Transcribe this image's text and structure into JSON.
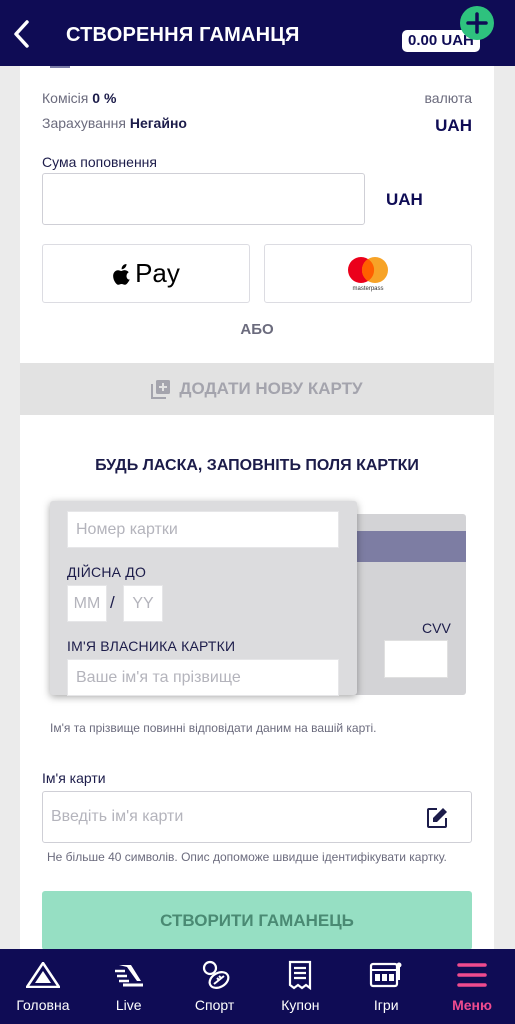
{
  "header": {
    "title": "СТВОРЕННЯ ГАМАНЦЯ",
    "balance": "0.00 UAH"
  },
  "info": {
    "commission_label": "Комісія",
    "commission_value": "0 %",
    "crediting_label": "Зарахування",
    "crediting_value": "Негайно",
    "currency_label": "валюта",
    "currency_value": "UAH"
  },
  "amount": {
    "label": "Сума поповнення",
    "value": "",
    "currency": "UAH"
  },
  "payment": {
    "applepay_label": "Pay",
    "masterpass_label": "masterpass",
    "or_label": "АБО"
  },
  "add_card": {
    "label": "ДОДАТИ НОВУ КАРТУ"
  },
  "card_form": {
    "title": "БУДЬ ЛАСКА, ЗАПОВНІТЬ ПОЛЯ КАРТКИ",
    "number_placeholder": "Номер картки",
    "valid_label": "ДІЙСНА ДО",
    "mm_placeholder": "MM",
    "slash": "/",
    "yy_placeholder": "YY",
    "holder_label": "ІМ'Я ВЛАСНИКА КАРТКИ",
    "holder_placeholder": "Ваше ім'я та прізвище",
    "cvv_label": "CVV",
    "note": "Ім'я та прізвище повинні відповідати даним на вашій карті."
  },
  "card_name": {
    "label": "Ім'я карти",
    "placeholder": "Введіть ім'я карти",
    "note": "Не більше 40 символів. Опис допоможе швидше ідентифікувати картку."
  },
  "create_button": "СТВОРИТИ ГАМАНЕЦЬ",
  "nav": {
    "items": [
      {
        "label": "Головна",
        "icon": "home-icon"
      },
      {
        "label": "Live",
        "icon": "live-icon"
      },
      {
        "label": "Спорт",
        "icon": "sport-icon"
      },
      {
        "label": "Купон",
        "icon": "coupon-icon"
      },
      {
        "label": "Ігри",
        "icon": "games-icon"
      },
      {
        "label": "Меню",
        "icon": "menu-icon"
      }
    ],
    "active_color": "#f04b8f"
  },
  "colors": {
    "brand": "#0f0c55",
    "accent_green": "#2ec27e",
    "create_button": "#96dfc3"
  }
}
